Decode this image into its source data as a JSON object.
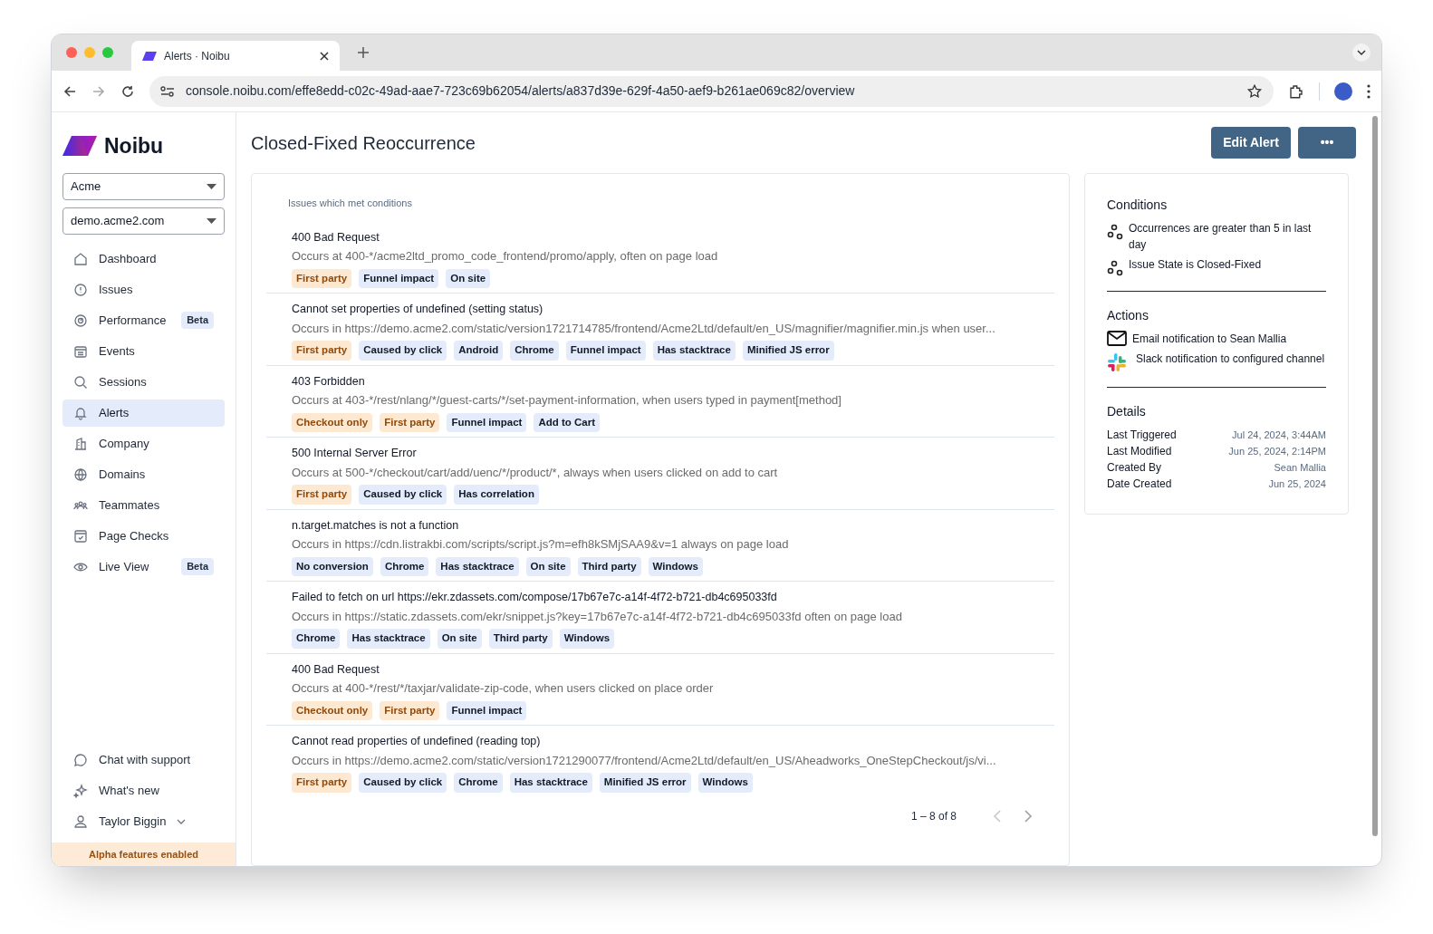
{
  "browser": {
    "tab_title": "Alerts · Noibu",
    "url": "console.noibu.com/effe8edd-c02c-49ad-aae7-723c69b62054/alerts/a837d39e-629f-4a50-aef9-b261ae069c82/overview"
  },
  "sidebar": {
    "logo": "Noibu",
    "selects": [
      "Acme",
      "demo.acme2.com"
    ],
    "items": [
      {
        "label": "Dashboard",
        "selected": false
      },
      {
        "label": "Issues",
        "selected": false
      },
      {
        "label": "Performance",
        "selected": false,
        "badge": "Beta"
      },
      {
        "label": "Events",
        "selected": false
      },
      {
        "label": "Sessions",
        "selected": false
      },
      {
        "label": "Alerts",
        "selected": true
      },
      {
        "label": "Company",
        "selected": false
      },
      {
        "label": "Domains",
        "selected": false
      },
      {
        "label": "Teammates",
        "selected": false
      },
      {
        "label": "Page Checks",
        "selected": false
      },
      {
        "label": "Live View",
        "selected": false,
        "badge": "Beta"
      }
    ],
    "bottom_items": [
      "Chat with support",
      "What's new",
      "Taylor Biggin"
    ],
    "banner": "Alpha features enabled"
  },
  "page": {
    "title": "Closed-Fixed Reoccurrence",
    "buttons": [
      "Edit Alert",
      "•••"
    ]
  },
  "issues": {
    "heading": "Issues which met conditions",
    "rows": [
      {
        "title": "400 Bad Request",
        "description": "Occurs at 400-*/acme2ltd_promo_code_frontend/promo/apply, often on page load",
        "tags": [
          {
            "label": "First party",
            "kind": "highlight"
          },
          {
            "label": "Funnel impact",
            "kind": "default"
          },
          {
            "label": "On site",
            "kind": "default"
          }
        ]
      },
      {
        "title": "Cannot set properties of undefined (setting status)",
        "description": "Occurs in https://demo.acme2.com/static/version1721714785/frontend/Acme2Ltd/default/en_US/magnifier/magnifier.min.js when user...",
        "tags": [
          {
            "label": "First party",
            "kind": "highlight"
          },
          {
            "label": "Caused by click",
            "kind": "default"
          },
          {
            "label": "Android",
            "kind": "default"
          },
          {
            "label": "Chrome",
            "kind": "default"
          },
          {
            "label": "Funnel impact",
            "kind": "default"
          },
          {
            "label": "Has stacktrace",
            "kind": "default"
          },
          {
            "label": "Minified JS error",
            "kind": "default"
          }
        ]
      },
      {
        "title": "403 Forbidden",
        "description": "Occurs at 403-*/rest/nlang/*/guest-carts/*/set-payment-information, when users typed in payment[method]",
        "tags": [
          {
            "label": "Checkout only",
            "kind": "highlight"
          },
          {
            "label": "First party",
            "kind": "highlight"
          },
          {
            "label": "Funnel impact",
            "kind": "default"
          },
          {
            "label": "Add to Cart",
            "kind": "default"
          }
        ]
      },
      {
        "title": "500 Internal Server Error",
        "description": "Occurs at 500-*/checkout/cart/add/uenc/*/product/*, always when users clicked on add to cart",
        "tags": [
          {
            "label": "First party",
            "kind": "highlight"
          },
          {
            "label": "Caused by click",
            "kind": "default"
          },
          {
            "label": "Has correlation",
            "kind": "default"
          }
        ]
      },
      {
        "title": "n.target.matches is not a function",
        "description": "Occurs in https://cdn.listrakbi.com/scripts/script.js?m=efh8kSMjSAA9&v=1 always on page load",
        "tags": [
          {
            "label": "No conversion",
            "kind": "default"
          },
          {
            "label": "Chrome",
            "kind": "default"
          },
          {
            "label": "Has stacktrace",
            "kind": "default"
          },
          {
            "label": "On site",
            "kind": "default"
          },
          {
            "label": "Third party",
            "kind": "default"
          },
          {
            "label": "Windows",
            "kind": "default"
          }
        ]
      },
      {
        "title": "Failed to fetch on url https://ekr.zdassets.com/compose/17b67e7c-a14f-4f72-b721-db4c695033fd",
        "description": "Occurs in https://static.zdassets.com/ekr/snippet.js?key=17b67e7c-a14f-4f72-b721-db4c695033fd often on page load",
        "tags": [
          {
            "label": "Chrome",
            "kind": "default"
          },
          {
            "label": "Has stacktrace",
            "kind": "default"
          },
          {
            "label": "On site",
            "kind": "default"
          },
          {
            "label": "Third party",
            "kind": "default"
          },
          {
            "label": "Windows",
            "kind": "default"
          }
        ]
      },
      {
        "title": "400 Bad Request",
        "description": "Occurs at 400-*/rest/*/taxjar/validate-zip-code, when users clicked on place order",
        "tags": [
          {
            "label": "Checkout only",
            "kind": "highlight"
          },
          {
            "label": "First party",
            "kind": "highlight"
          },
          {
            "label": "Funnel impact",
            "kind": "default"
          }
        ]
      },
      {
        "title": "Cannot read properties of undefined (reading top)",
        "description": "Occurs in https://demo.acme2.com/static/version1721290077/frontend/Acme2Ltd/default/en_US/Aheadworks_OneStepCheckout/js/vi...",
        "tags": [
          {
            "label": "First party",
            "kind": "highlight"
          },
          {
            "label": "Caused by click",
            "kind": "default"
          },
          {
            "label": "Chrome",
            "kind": "default"
          },
          {
            "label": "Has stacktrace",
            "kind": "default"
          },
          {
            "label": "Minified JS error",
            "kind": "default"
          },
          {
            "label": "Windows",
            "kind": "default"
          }
        ]
      }
    ],
    "pagination": "1 – 8 of 8"
  },
  "panel": {
    "conditions": {
      "heading": "Conditions",
      "items": [
        "Occurrences are greater than 5 in last day",
        "Issue State is Closed-Fixed"
      ]
    },
    "actions": {
      "heading": "Actions",
      "items": [
        {
          "kind": "email",
          "text": "Email notification to Sean Mallia"
        },
        {
          "kind": "slack",
          "text": "Slack notification to configured channel"
        }
      ]
    },
    "details": {
      "heading": "Details",
      "rows": [
        {
          "label": "Last Triggered",
          "value": "Jul 24, 2024, 3:44AM"
        },
        {
          "label": "Last Modified",
          "value": "Jun 25, 2024, 2:14PM"
        },
        {
          "label": "Created By",
          "value": "Sean Mallia"
        },
        {
          "label": "Date Created",
          "value": "Jun 25, 2024"
        }
      ]
    }
  }
}
